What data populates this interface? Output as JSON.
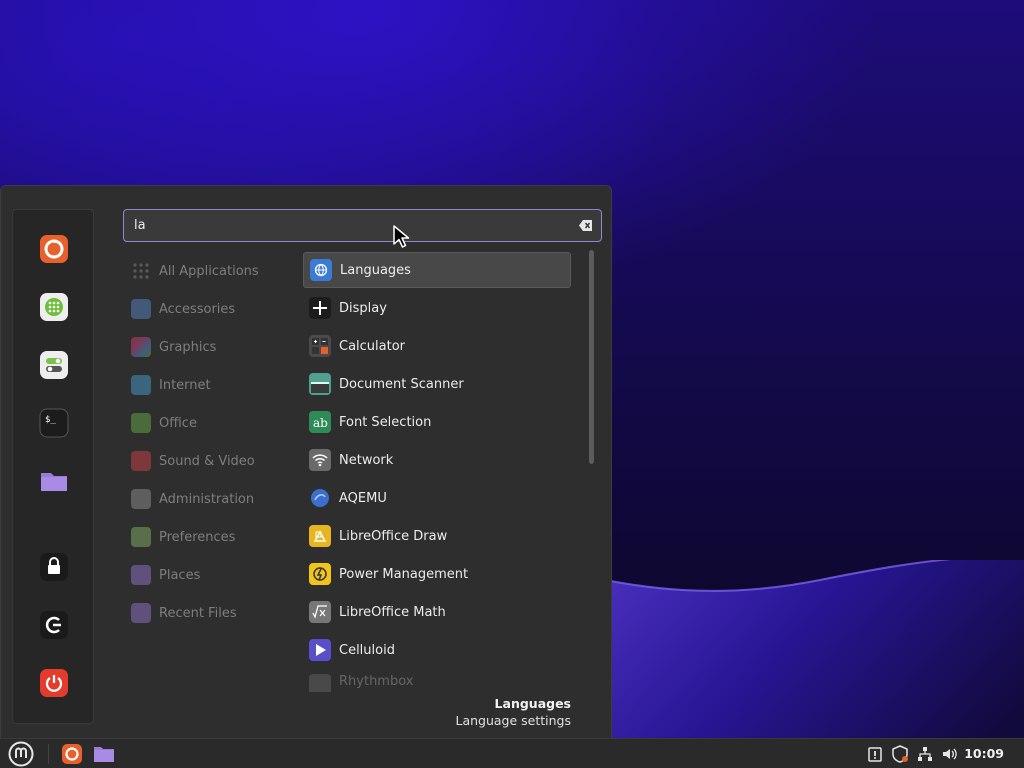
{
  "search": {
    "value": "la",
    "clear_icon": "backspace-icon"
  },
  "favorites": [
    {
      "name": "firefox",
      "icon": "firefox-icon",
      "color": "#e8602c"
    },
    {
      "name": "software-manager",
      "icon": "software-manager-icon",
      "color": "#6cbf3b"
    },
    {
      "name": "settings",
      "icon": "settings-toggle-icon",
      "color": "#7ac24a"
    },
    {
      "name": "terminal",
      "icon": "terminal-icon",
      "color": "#2b2b2b"
    },
    {
      "name": "files",
      "icon": "folder-icon",
      "color": "#9b7cdb"
    },
    {
      "name": "lock-screen",
      "icon": "lock-icon",
      "color": "#1e1e1e"
    },
    {
      "name": "logout",
      "icon": "logout-icon",
      "color": "#1e1e1e"
    },
    {
      "name": "shutdown",
      "icon": "power-icon",
      "color": "#e53b2c"
    }
  ],
  "categories": [
    {
      "label": "All Applications",
      "icon": "grid-icon",
      "color": "#555555"
    },
    {
      "label": "Accessories",
      "icon": "scissors-icon",
      "color": "#5b8fd8"
    },
    {
      "label": "Graphics",
      "icon": "palette-icon",
      "color": "#d9468a"
    },
    {
      "label": "Internet",
      "icon": "cloud-icon",
      "color": "#4aa8e0"
    },
    {
      "label": "Office",
      "icon": "office-icon",
      "color": "#6cb84b"
    },
    {
      "label": "Sound & Video",
      "icon": "play-icon",
      "color": "#e0444a"
    },
    {
      "label": "Administration",
      "icon": "admin-icon",
      "color": "#9a9a9a"
    },
    {
      "label": "Preferences",
      "icon": "preferences-icon",
      "color": "#8fbf6a"
    },
    {
      "label": "Places",
      "icon": "folder-icon",
      "color": "#9b7cdb"
    },
    {
      "label": "Recent Files",
      "icon": "recent-folder-icon",
      "color": "#9b7cdb"
    }
  ],
  "apps": [
    {
      "label": "Languages",
      "icon": "languages-icon",
      "color": "#3a7bd5",
      "selected": true
    },
    {
      "label": "Display",
      "icon": "display-icon",
      "color": "#1c1c1c"
    },
    {
      "label": "Calculator",
      "icon": "calculator-icon",
      "color": "#4a4a4a"
    },
    {
      "label": "Document Scanner",
      "icon": "scanner-icon",
      "color": "#4fa08f"
    },
    {
      "label": "Font Selection",
      "icon": "font-icon",
      "color": "#2e8b57"
    },
    {
      "label": "Network",
      "icon": "wifi-icon",
      "color": "#6a6a6a"
    },
    {
      "label": "AQEMU",
      "icon": "aqemu-icon",
      "color": "#3a6fd0"
    },
    {
      "label": "LibreOffice Draw",
      "icon": "libreoffice-draw-icon",
      "color": "#e8b520"
    },
    {
      "label": "Power Management",
      "icon": "power-management-icon",
      "color": "#f0c419"
    },
    {
      "label": "LibreOffice Math",
      "icon": "libreoffice-math-icon",
      "color": "#777777"
    },
    {
      "label": "Celluloid",
      "icon": "celluloid-icon",
      "color": "#5a4fc8"
    },
    {
      "label": "Rhythmbox",
      "icon": "rhythmbox-icon",
      "color": "#888888",
      "faded": true
    }
  ],
  "description": {
    "title": "Languages",
    "text": "Language settings"
  },
  "taskbar": {
    "menu_icon": "linux-mint-logo-icon",
    "launchers": [
      {
        "name": "firefox",
        "icon": "firefox-icon"
      },
      {
        "name": "files",
        "icon": "folder-icon"
      }
    ],
    "tray": [
      "update-manager-icon",
      "shield-icon",
      "network-icon",
      "volume-icon"
    ],
    "clock": "10:09"
  }
}
